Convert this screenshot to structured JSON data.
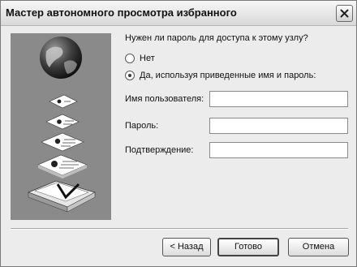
{
  "window": {
    "title": "Мастер автономного просмотра избранного"
  },
  "form": {
    "question": "Нужен ли пароль для доступа к этому узлу?",
    "options": [
      {
        "label": "Нет",
        "selected": false
      },
      {
        "label": "Да, используя приведенные имя и пароль:",
        "selected": true
      }
    ],
    "fields": {
      "username": {
        "label": "Имя пользователя:",
        "value": ""
      },
      "password": {
        "label": "Пароль:",
        "value": ""
      },
      "confirm": {
        "label": "Подтверждение:",
        "value": ""
      }
    }
  },
  "buttons": {
    "back": "< Назад",
    "finish": "Готово",
    "cancel": "Отмена"
  },
  "icons": {
    "close": "close-icon",
    "illustration": [
      "globe-icon",
      "document-stack-icon",
      "folder-icon"
    ]
  }
}
